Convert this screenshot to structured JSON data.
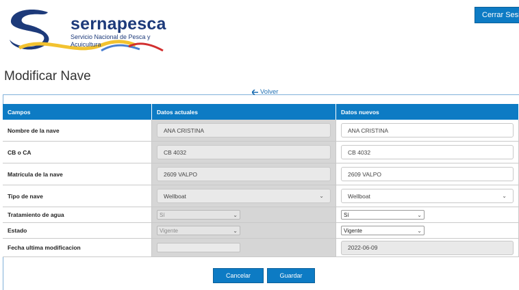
{
  "brand": {
    "name": "sernapesca",
    "subtitle": "Servicio Nacional de Pesca y Acuicultura"
  },
  "header": {
    "logout_label": "Cerrar Sesión"
  },
  "page": {
    "title": "Modificar Nave",
    "back_label": "Volver"
  },
  "table": {
    "headers": [
      "Campos",
      "Datos actuales",
      "Datos nuevos"
    ],
    "rows": {
      "nombre": {
        "label": "Nombre de la nave",
        "current": "ANA CRISTINA",
        "new": "ANA CRISTINA"
      },
      "cb": {
        "label": "CB o CA",
        "current": "CB 4032",
        "new": "CB 4032"
      },
      "matricula": {
        "label": "Matrícula de la nave",
        "current": "2609 VALPO",
        "new": "2609 VALPO"
      },
      "tipo": {
        "label": "Tipo de nave",
        "current": "Wellboat",
        "new": "Wellboat"
      },
      "tratamiento": {
        "label": "Tratamiento de agua",
        "current": "Sí",
        "new": "Sí"
      },
      "estado": {
        "label": "Estado",
        "current": "Vigente",
        "new": "Vigente"
      },
      "fecha": {
        "label": "Fecha ultima modificacion",
        "current": "",
        "new": "2022-06-09"
      }
    }
  },
  "actions": {
    "cancel_label": "Cancelar",
    "save_label": "Guardar"
  },
  "colors": {
    "primary": "#0d7bc4",
    "brand_navy": "#1d3a7a",
    "brand_yellow": "#f2c230",
    "brand_red": "#d22f2f"
  }
}
